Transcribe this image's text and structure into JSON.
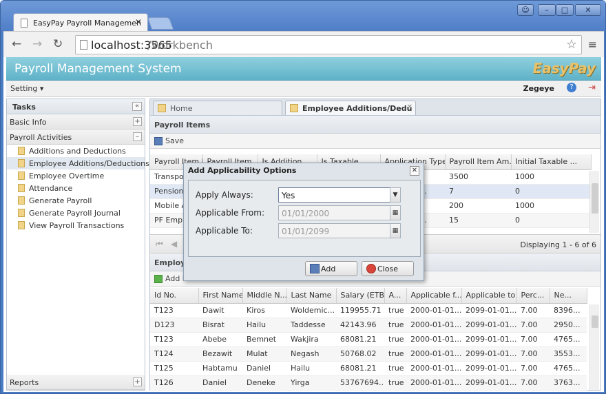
{
  "browser": {
    "tab_title": "EasyPay Payroll Managemen",
    "url_host": "localhost:3565",
    "url_path": "/Workbench"
  },
  "app": {
    "title": "Payroll Management System",
    "logo_text": "EasyPay",
    "setting_label": "Setting",
    "user_name": "Zegeye"
  },
  "west": {
    "title": "Tasks",
    "basic_info": "Basic Info",
    "payroll_activities": "Payroll Activities",
    "items": [
      "Additions and Deductions",
      "Employee Additions/Deductions",
      "Employee Overtime",
      "Attendance",
      "Generate Payroll",
      "Generate Payroll Journal",
      "View Payroll Transactions"
    ],
    "reports": "Reports"
  },
  "center": {
    "tabs": [
      "Home",
      "Employee Additions/Dedu"
    ],
    "payroll_items_title": "Payroll Items",
    "save_label": "Save",
    "payroll_columns": [
      "Payroll Item N...",
      "Payroll Item...",
      "Is Addition",
      "Is Taxable",
      "Application Type",
      "Payroll Item Am...",
      "Initial Taxable ..."
    ],
    "payroll_rows": [
      [
        "Transport",
        "",
        "",
        "",
        "Amount",
        "3500",
        "1000"
      ],
      [
        "Pension E",
        "",
        "",
        "",
        "ntage Of ...",
        "7",
        "0"
      ],
      [
        "Mobile All",
        "",
        "",
        "",
        "Amount",
        "200",
        "1000"
      ],
      [
        "PF Employ",
        "",
        "",
        "",
        "ntage Of ...",
        "15",
        "0"
      ]
    ],
    "paging_info": "Displaying 1 - 6 of 6",
    "employee_title": "Employe",
    "add_label": "Add E",
    "employee_columns": [
      "Id No.",
      "First Name",
      "Middle N...",
      "Last Name",
      "Salary (ETB)",
      "A...",
      "Applicable f...",
      "Applicable to",
      "Perc...",
      "Ne..."
    ],
    "employee_rows": [
      [
        "T123",
        "Dawit",
        "Kiros",
        "Woldemic...",
        "119955.71",
        "true",
        "2000-01-01...",
        "2099-01-01...",
        "7.00",
        "8396..."
      ],
      [
        "D123",
        "Bisrat",
        "Hailu",
        "Taddesse",
        "42143.96",
        "true",
        "2000-01-01...",
        "2099-01-01...",
        "7.00",
        "2950..."
      ],
      [
        "T123",
        "Abebe",
        "Bemnet",
        "Wakjira",
        "68081.21",
        "true",
        "2000-01-01...",
        "2099-01-01...",
        "7.00",
        "4765..."
      ],
      [
        "T124",
        "Bezawit",
        "Mulat",
        "Negash",
        "50768.02",
        "true",
        "2000-01-01...",
        "2099-01-01...",
        "7.00",
        "3553..."
      ],
      [
        "T125",
        "Habtamu",
        "Daniel",
        "Hailu",
        "68081.21",
        "true",
        "2000-01-01...",
        "2099-01-01...",
        "7.00",
        "4765..."
      ],
      [
        "T126",
        "Daniel",
        "Deneke",
        "Yirga",
        "53767694...",
        "true",
        "2000-01-01...",
        "2099-01-01...",
        "7.00",
        "3763..."
      ]
    ]
  },
  "dialog": {
    "title": "Add Applicability Options",
    "apply_always_label": "Apply Always:",
    "apply_always_value": "Yes",
    "from_label": "Applicable From:",
    "from_value": "01/01/2000",
    "to_label": "Applicable To:",
    "to_value": "01/01/2099",
    "add_button": "Add",
    "close_button": "Close"
  }
}
